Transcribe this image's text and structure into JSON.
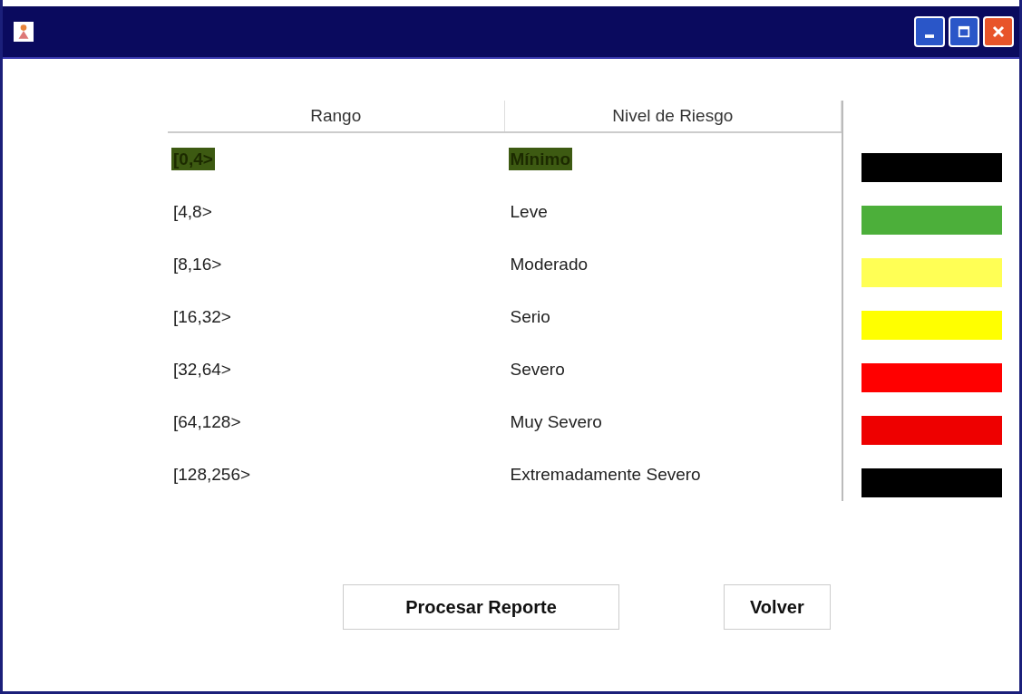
{
  "table": {
    "columns": [
      "Rango",
      "Nivel de Riesgo"
    ],
    "rows": [
      {
        "cells": [
          "[0,4>",
          "Mínimo"
        ],
        "selected": true
      },
      {
        "cells": [
          "[4,8>",
          "Leve"
        ],
        "selected": false
      },
      {
        "cells": [
          "[8,16>",
          "Moderado"
        ],
        "selected": false
      },
      {
        "cells": [
          "[16,32>",
          "Serio"
        ],
        "selected": false
      },
      {
        "cells": [
          "[32,64>",
          "Severo"
        ],
        "selected": false
      },
      {
        "cells": [
          "[64,128>",
          "Muy Severo"
        ],
        "selected": false
      },
      {
        "cells": [
          "[128,256>",
          "Extremadamente Severo"
        ],
        "selected": false
      }
    ]
  },
  "legend": [
    {
      "color": "#000000"
    },
    {
      "color": "#4caf3a"
    },
    {
      "color": "#ffff55"
    },
    {
      "color": "#ffff00"
    },
    {
      "color": "#ff0000"
    },
    {
      "color": "#ee0000"
    },
    {
      "color": "#000000"
    }
  ],
  "buttons": [
    "Procesar Reporte",
    "Volver"
  ]
}
